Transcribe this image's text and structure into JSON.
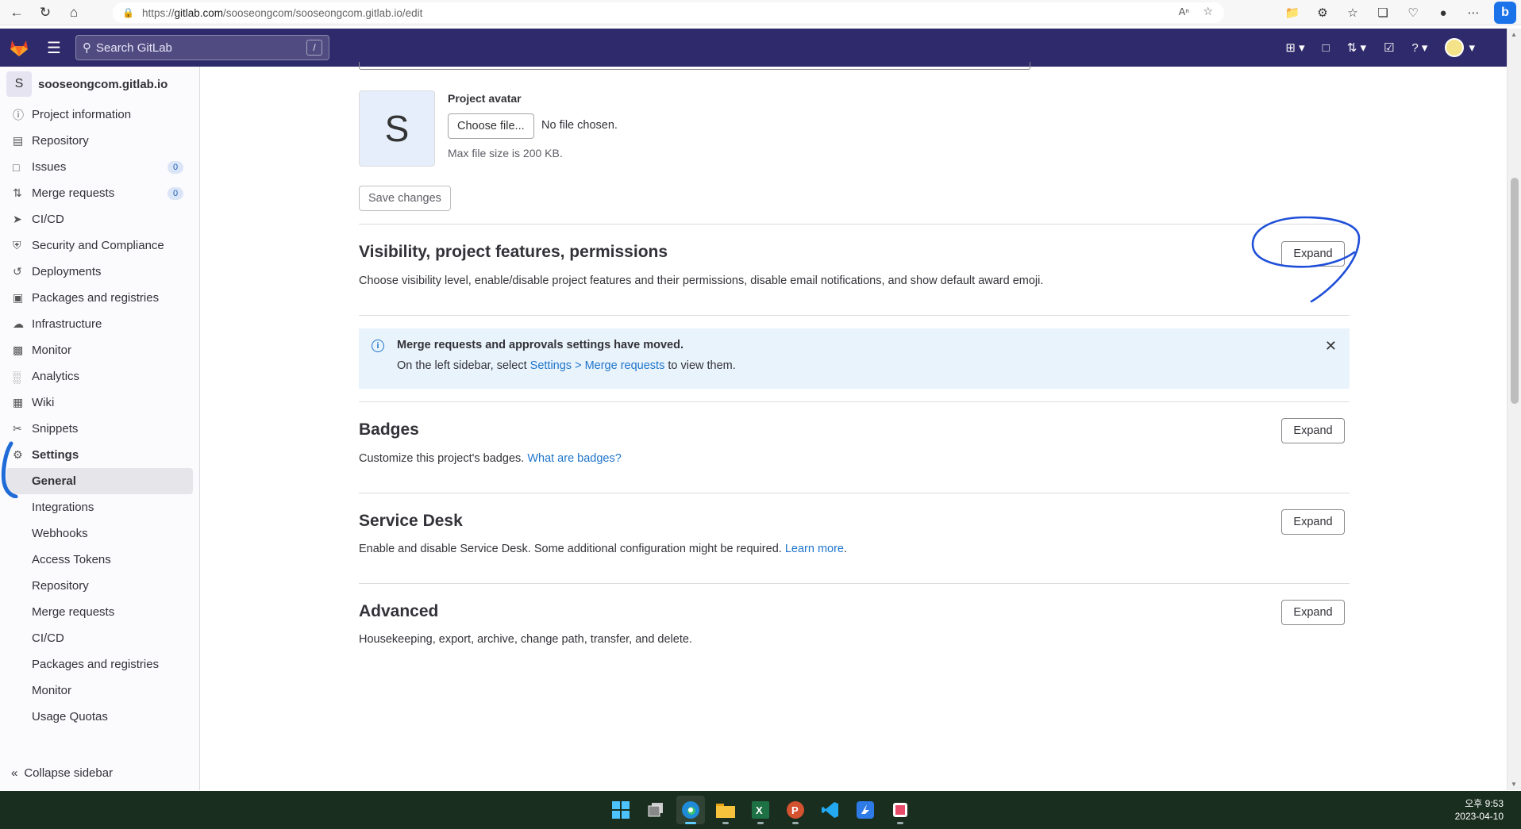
{
  "browser": {
    "url_prefix": "https://",
    "url_host": "gitlab.com",
    "url_path": "/sooseongcom/sooseongcom.gitlab.io/edit"
  },
  "topnav": {
    "search_placeholder": "Search GitLab",
    "search_shortcut": "/"
  },
  "sidebar": {
    "project_initial": "S",
    "project_name": "sooseongcom.gitlab.io",
    "items": [
      {
        "label": "Project information",
        "icon": "info-icon"
      },
      {
        "label": "Repository",
        "icon": "doc-icon"
      },
      {
        "label": "Issues",
        "icon": "issues-icon",
        "badge": "0"
      },
      {
        "label": "Merge requests",
        "icon": "merge-request-icon",
        "badge": "0"
      },
      {
        "label": "CI/CD",
        "icon": "rocket-icon"
      },
      {
        "label": "Security and Compliance",
        "icon": "shield-icon"
      },
      {
        "label": "Deployments",
        "icon": "deployments-icon"
      },
      {
        "label": "Packages and registries",
        "icon": "package-icon"
      },
      {
        "label": "Infrastructure",
        "icon": "cloud-icon"
      },
      {
        "label": "Monitor",
        "icon": "monitor-icon"
      },
      {
        "label": "Analytics",
        "icon": "chart-icon"
      },
      {
        "label": "Wiki",
        "icon": "book-icon"
      },
      {
        "label": "Snippets",
        "icon": "scissors-icon"
      },
      {
        "label": "Settings",
        "icon": "gear-icon"
      }
    ],
    "settings_sub": [
      "General",
      "Integrations",
      "Webhooks",
      "Access Tokens",
      "Repository",
      "Merge requests",
      "CI/CD",
      "Packages and registries",
      "Monitor",
      "Usage Quotas"
    ],
    "collapse_label": "Collapse sidebar"
  },
  "main": {
    "avatar_initial": "S",
    "avatar_label": "Project avatar",
    "choose_file": "Choose file...",
    "no_file": "No file chosen.",
    "max_size": "Max file size is 200 KB.",
    "save_changes": "Save changes",
    "expand_label": "Expand",
    "visibility": {
      "title": "Visibility, project features, permissions",
      "desc": "Choose visibility level, enable/disable project features and their permissions, disable email notifications, and show default award emoji."
    },
    "alert": {
      "title": "Merge requests and approvals settings have moved.",
      "text_before": "On the left sidebar, select ",
      "link": "Settings > Merge requests",
      "text_after": " to view them."
    },
    "badges": {
      "title": "Badges",
      "desc": "Customize this project's badges. ",
      "link": "What are badges?"
    },
    "service_desk": {
      "title": "Service Desk",
      "desc": "Enable and disable Service Desk. Some additional configuration might be required. ",
      "link": "Learn more",
      "after": "."
    },
    "advanced": {
      "title": "Advanced",
      "desc": "Housekeeping, export, archive, change path, transfer, and delete."
    }
  },
  "taskbar": {
    "time": "오후 9:53",
    "date": "2023-04-10"
  },
  "colors": {
    "gitlab_nav": "#2f2a6b",
    "link": "#1f75cb",
    "annotation": "#1f4fd8"
  }
}
